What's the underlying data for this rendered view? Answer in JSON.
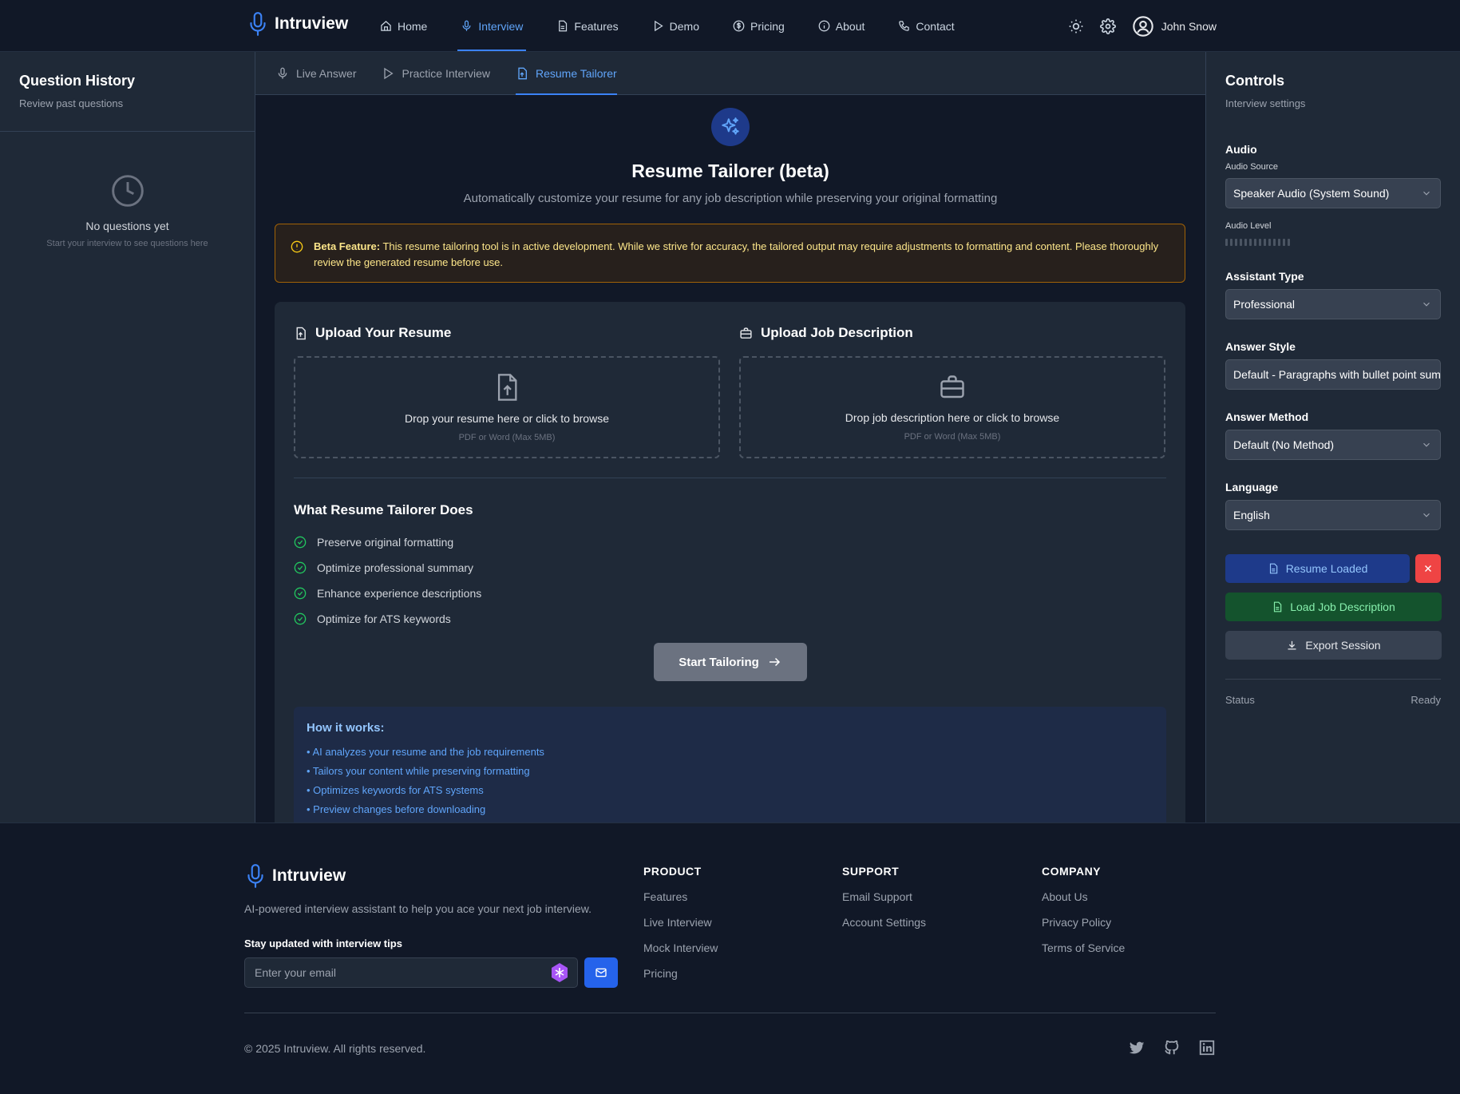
{
  "brand": {
    "name": "Intruview"
  },
  "nav": {
    "items": [
      {
        "label": "Home",
        "icon": "home-icon"
      },
      {
        "label": "Interview",
        "icon": "mic-icon",
        "active": true
      },
      {
        "label": "Features",
        "icon": "document-icon"
      },
      {
        "label": "Demo",
        "icon": "play-icon"
      },
      {
        "label": "Pricing",
        "icon": "dollar-icon"
      },
      {
        "label": "About",
        "icon": "info-icon"
      },
      {
        "label": "Contact",
        "icon": "phone-icon"
      }
    ]
  },
  "user": {
    "name": "John Snow"
  },
  "question_history": {
    "title": "Question History",
    "subtitle": "Review past questions",
    "empty_title": "No questions yet",
    "empty_subtitle": "Start your interview to see questions here"
  },
  "tabs": [
    {
      "label": "Live Answer",
      "icon": "mic-icon"
    },
    {
      "label": "Practice Interview",
      "icon": "play-icon"
    },
    {
      "label": "Resume Tailorer",
      "icon": "file-upload-icon",
      "active": true
    }
  ],
  "tailor": {
    "title": "Resume Tailorer (beta)",
    "subtitle": "Automatically customize your resume for any job description while preserving your original formatting",
    "beta_label": "Beta Feature:",
    "beta_text": " This resume tailoring tool is in active development. While we strive for accuracy, the tailored output may require adjustments to formatting and content. Please thoroughly review the generated resume before use.",
    "upload_resume": {
      "title": "Upload Your Resume",
      "drop_text": "Drop your resume here or click to browse",
      "hint": "PDF or Word (Max 5MB)"
    },
    "upload_job": {
      "title": "Upload Job Description",
      "drop_text": "Drop job description here or click to browse",
      "hint": "PDF or Word (Max 5MB)"
    },
    "does_title": "What Resume Tailorer Does",
    "does_items": [
      "Preserve original formatting",
      "Optimize professional summary",
      "Enhance experience descriptions",
      "Optimize for ATS keywords"
    ],
    "start_button": "Start Tailoring",
    "how_title": "How it works:",
    "how_items": [
      "• AI analyzes your resume and the job requirements",
      "• Tailors your content while preserving formatting",
      "• Optimizes keywords for ATS systems",
      "• Preview changes before downloading"
    ]
  },
  "controls": {
    "title": "Controls",
    "subtitle": "Interview settings",
    "audio_section": "Audio",
    "audio_source_label": "Audio Source",
    "audio_source_value": "Speaker Audio (System Sound)",
    "audio_level_label": "Audio Level",
    "audio_level": 0,
    "assistant_type_label": "Assistant Type",
    "assistant_type_value": "Professional",
    "answer_style_label": "Answer Style",
    "answer_style_value": "Default - Paragraphs with bullet point summary",
    "answer_method_label": "Answer Method",
    "answer_method_value": "Default (No Method)",
    "language_label": "Language",
    "language_value": "English",
    "resume_loaded_button": "Resume Loaded",
    "load_job_button": "Load Job Description",
    "export_button": "Export Session",
    "status_label": "Status",
    "status_value": "Ready"
  },
  "footer": {
    "description": "AI-powered interview assistant to help you ace your next job interview.",
    "newsletter_title": "Stay updated with interview tips",
    "email_placeholder": "Enter your email",
    "columns": [
      {
        "title": "PRODUCT",
        "links": [
          "Features",
          "Live Interview",
          "Mock Interview",
          "Pricing"
        ]
      },
      {
        "title": "SUPPORT",
        "links": [
          "Email Support",
          "Account Settings"
        ]
      },
      {
        "title": "COMPANY",
        "links": [
          "About Us",
          "Privacy Policy",
          "Terms of Service"
        ]
      }
    ],
    "copyright": "© 2025 Intruview. All rights reserved.",
    "social": [
      "twitter-icon",
      "github-icon",
      "linkedin-icon"
    ]
  },
  "colors": {
    "accent": "#3b82f6",
    "background": "#111827",
    "panel": "#1f2937",
    "warning_border": "#a16207",
    "success": "#22c55e",
    "danger": "#ef4444"
  }
}
